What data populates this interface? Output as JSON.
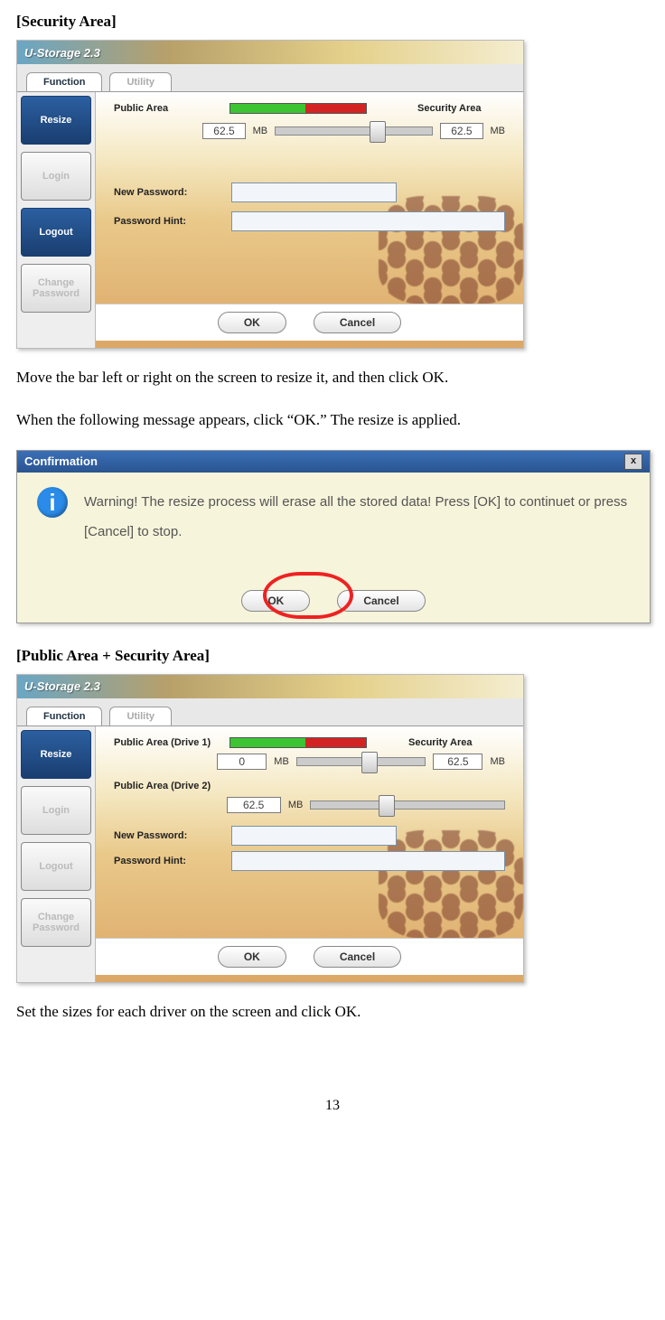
{
  "section1_title": "[Security Area]",
  "section2_title": "[Public Area + Security Area]",
  "para1": "Move the bar left or right on the screen to resize it, and then click OK.",
  "para2": "When the following message appears, click “OK.” The resize is applied.",
  "para3": "Set the sizes for each driver on the screen and click OK.",
  "page_number": "13",
  "app": {
    "title": "U-Storage 2.3",
    "tabs": [
      "Function",
      "Utility"
    ],
    "sidebar": {
      "resize": "Resize",
      "login": "Login",
      "logout": "Logout",
      "change_pw": "Change Password"
    },
    "labels": {
      "public_area": "Public Area",
      "security_area": "Security Area",
      "public_area_d1": "Public Area (Drive 1)",
      "public_area_d2": "Public Area (Drive 2)",
      "new_password": "New Password:",
      "password_hint": "Password Hint:",
      "mb": "MB"
    },
    "values": {
      "public_mb": "62.5",
      "security_mb": "62.5",
      "d1_public_mb": "0",
      "d1_security_mb": "62.5",
      "d2_public_mb": "62.5"
    },
    "buttons": {
      "ok": "OK",
      "cancel": "Cancel"
    }
  },
  "dialog": {
    "title": "Confirmation",
    "text": "Warning! The resize process will erase all the stored data! Press [OK] to continuet or press [Cancel] to stop.",
    "ok": "OK",
    "cancel": "Cancel",
    "close": "x"
  }
}
